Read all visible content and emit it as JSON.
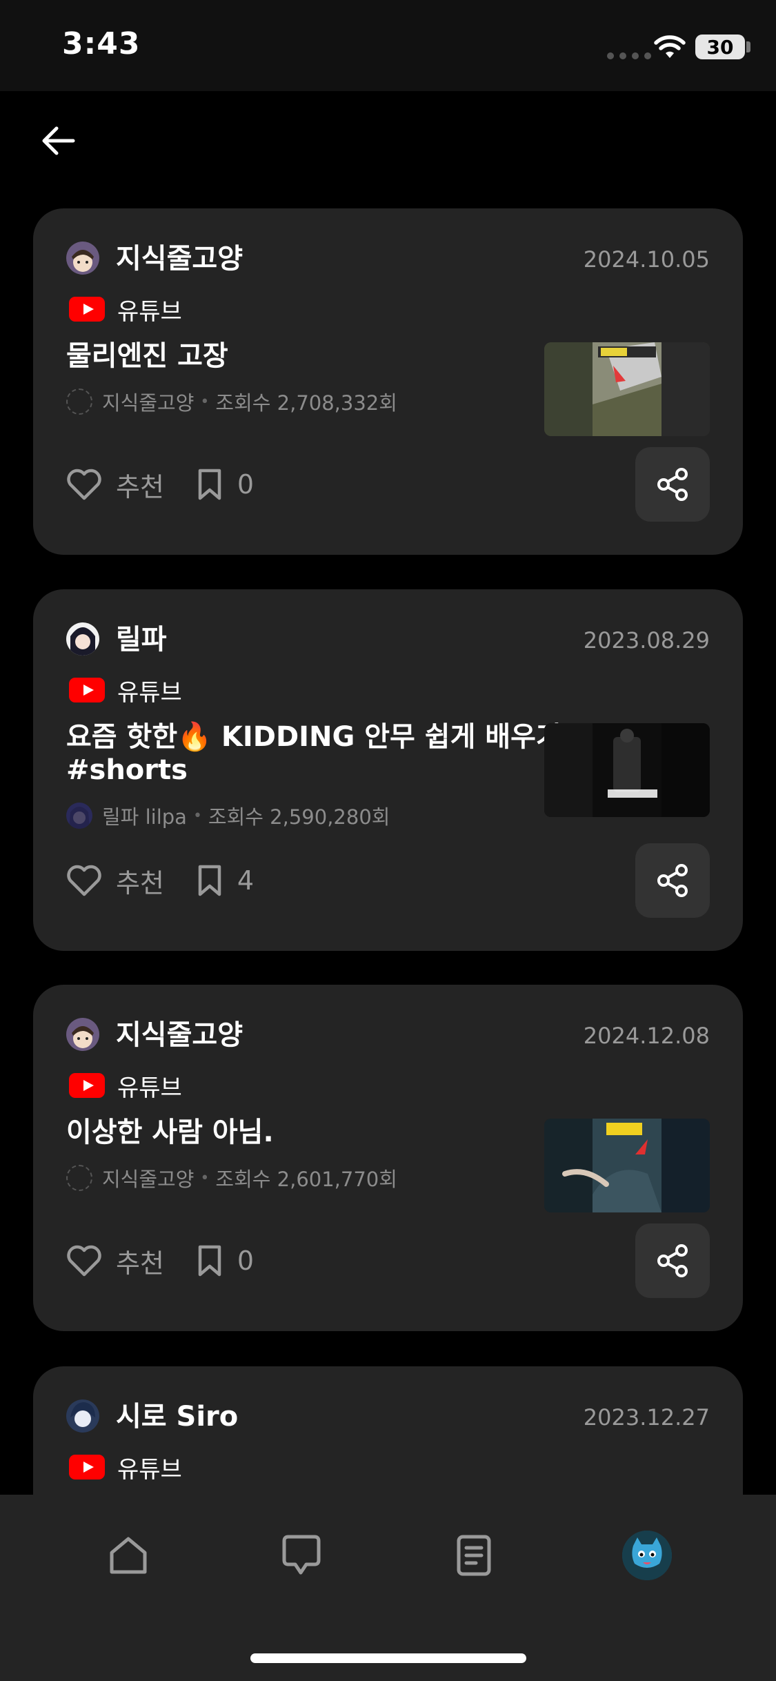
{
  "status_bar": {
    "time": "3:43",
    "battery": "30"
  },
  "posts": [
    {
      "author": "지식줄고양",
      "date": "2024.10.05",
      "source": "유튜브",
      "title": "물리엔진 고장",
      "channel": "지식줄고양",
      "views": "조회수 2,708,332회",
      "like_label": "추천",
      "bookmark_count": "0"
    },
    {
      "author": "릴파",
      "date": "2023.08.29",
      "source": "유튜브",
      "title": "요즘 핫한🔥 KIDDING 안무 쉽게 배우기 #shorts",
      "channel": "릴파 lilpa",
      "views": "조회수 2,590,280회",
      "like_label": "추천",
      "bookmark_count": "4"
    },
    {
      "author": "지식줄고양",
      "date": "2024.12.08",
      "source": "유튜브",
      "title": "이상한 사람 아님.",
      "channel": "지식줄고양",
      "views": "조회수 2,601,770회",
      "like_label": "추천",
      "bookmark_count": "0"
    },
    {
      "author": "시로 Siro",
      "date": "2023.12.27",
      "source": "유튜브"
    }
  ],
  "nav": {
    "items": [
      "home-icon",
      "chat-icon",
      "document-icon",
      "profile-avatar"
    ]
  },
  "colors": {
    "background": "#000000",
    "card": "#242424",
    "muted_text": "#9a9a9a",
    "youtube_red": "#ff0000"
  }
}
